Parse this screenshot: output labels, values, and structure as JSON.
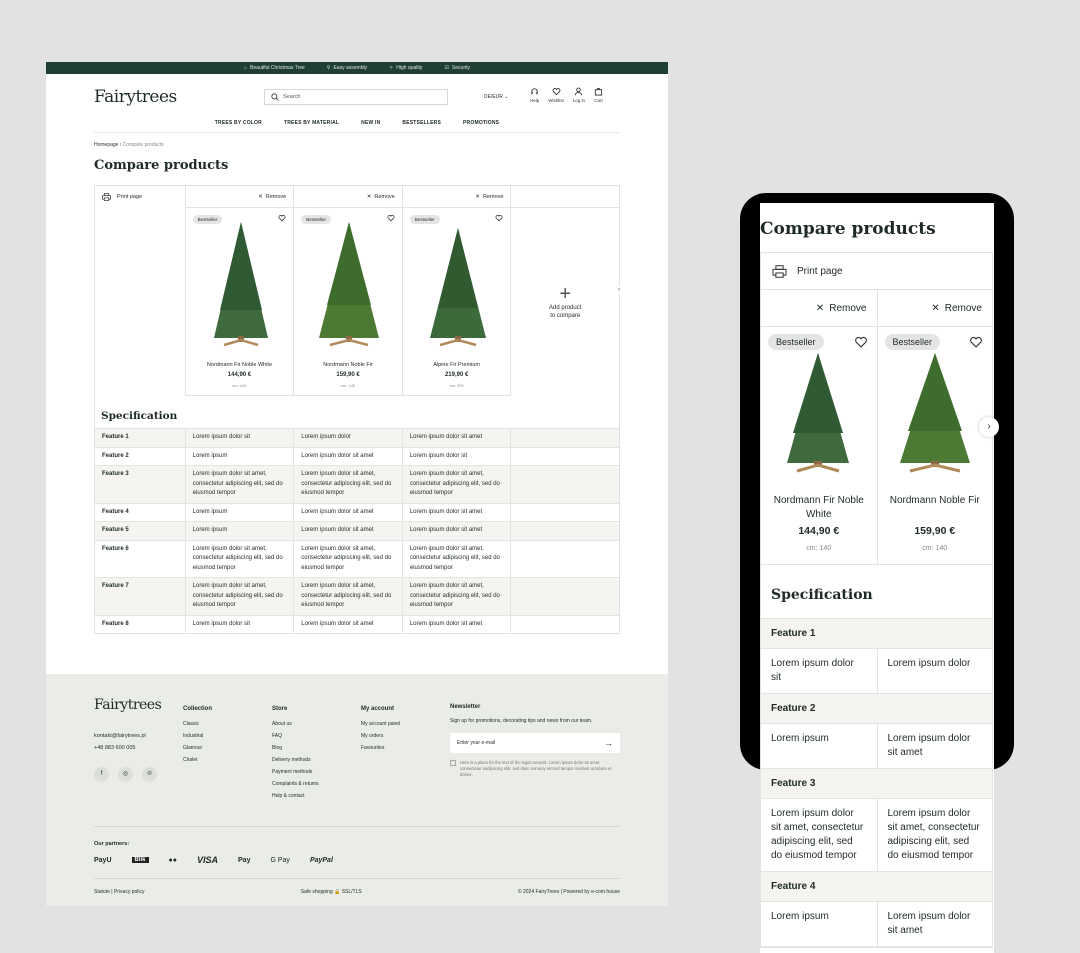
{
  "topbar": [
    "Beautiful Christmas Tree",
    "Easy assembly",
    "High quality",
    "Security"
  ],
  "header": {
    "logo": "Fairytrees",
    "search_placeholder": "Search",
    "lang": "DE/EUR",
    "icons": [
      "Help",
      "Wishlist",
      "Log in",
      "Cart"
    ]
  },
  "nav": [
    "TREES BY COLOR",
    "TREES BY MATERIAL",
    "NEW IN",
    "BESTSELLERS",
    "PROMOTIONS"
  ],
  "breadcrumb": {
    "home": "Homepage",
    "sep": "/",
    "current": "Compare products"
  },
  "title": "Compare products",
  "print_label": "Print page",
  "remove_label": "Remove",
  "add_label_1": "Add product",
  "add_label_2": "to compare",
  "products": [
    {
      "badge": "Bestseller",
      "name": "Nordmann Fir Noble White",
      "price": "144,90 €",
      "size": "cm: 140",
      "size_mobile": "cm:  140",
      "color": "#3f6a3e"
    },
    {
      "badge": "Bestseller",
      "name": "Nordmann Noble Fir",
      "price": "159,90 €",
      "size": "cm: 140",
      "size_mobile": "cm:  140",
      "color": "#4c7a34"
    },
    {
      "badge": "Bestseller",
      "name": "Alpine Fir Premium",
      "price": "219,90 €",
      "size": "cm: 200",
      "color": "#3d6a3a"
    }
  ],
  "spec_title": "Specification",
  "features": [
    {
      "name": "Feature 1",
      "values": [
        "Lorem ipsum dolor sit",
        "Lorem ipsum dolor",
        "Lorem ipsum dolor sit amet"
      ]
    },
    {
      "name": "Feature 2",
      "values": [
        "Lorem ipsum",
        "Lorem ipsum dolor sit amet",
        "Lorem ipsum dolor sit"
      ]
    },
    {
      "name": "Feature 3",
      "values": [
        "Lorem ipsum dolor sit amet, consectetur adipiscing elit, sed do eiusmod tempor",
        "Lorem ipsum dolor sit amet, consectetur adipiscing elit, sed do eiusmod tempor",
        "Lorem ipsum dolor sit amet, consectetur adipiscing elit, sed do eiusmod tempor"
      ]
    },
    {
      "name": "Feature 4",
      "values": [
        "Lorem ipsum",
        "Lorem ipsum dolor sit amet",
        "Lorem ipsum dolor sit amet"
      ]
    },
    {
      "name": "Feature 5",
      "values": [
        "Lorem ipsum",
        "Lorem ipsum dolor sit amet",
        "Lorem ipsum dolor sit amet"
      ]
    },
    {
      "name": "Feature 6",
      "values": [
        "Lorem ipsum dolor sit amet, consectetur adipiscing elit, sed do eiusmod tempor",
        "Lorem ipsum dolor sit amet, consectetur adipiscing elit, sed do eiusmod tempor",
        "Lorem ipsum dolor sit amet, consectetur adipiscing elit, sed do eiusmod tempor"
      ]
    },
    {
      "name": "Feature 7",
      "values": [
        "Lorem ipsum dolor sit amet, consectetur adipiscing elit, sed do eiusmod tempor",
        "Lorem ipsum dolor sit amet, consectetur adipiscing elit, sed do eiusmod tempor",
        "Lorem ipsum dolor sit amet, consectetur adipiscing elit, sed do eiusmod tempor"
      ]
    },
    {
      "name": "Feature 8",
      "values": [
        "Lorem ipsum dolor sit",
        "Lorem ipsum dolor sit amet",
        "Lorem ipsum dolor sit amet"
      ]
    }
  ],
  "footer": {
    "logo": "Fairytrees",
    "email": "kontakt@fairytrees.pl",
    "phone": "+48 883 600 005",
    "social": [
      "f",
      "◎",
      "℗"
    ],
    "collection": {
      "title": "Collection",
      "items": [
        "Classic",
        "Industrial",
        "Glamour",
        "Chalet"
      ]
    },
    "store": {
      "title": "Store",
      "items": [
        "About us",
        "FAQ",
        "Blog",
        "Delivery methods",
        "Payment methods",
        "Complaints & returns",
        "Help & contact"
      ]
    },
    "account": {
      "title": "My account",
      "items": [
        "My account panel",
        "My orders",
        "Favourites"
      ]
    },
    "newsletter": {
      "title": "Newsletter",
      "text": "Sign up for promotions, decorating tips and news from our team.",
      "placeholder": "Enter your e-mail",
      "consent": "Here is a place for the text of the legal consent. Lorem ipsum dolor sit amet, consectetur sadipscing elitr, sed diam nonumy eirmod tempor invidunt ut labore et dolore."
    },
    "partners_label": "Our partners:",
    "partners": [
      "PayU",
      "Blik",
      "●●",
      "VISA",
      "Pay",
      "G Pay",
      "PayPal"
    ],
    "statute": "Statute",
    "privacy": "Privacy policy",
    "safe": "Safe shopping",
    "ssl": "SSL/TLS",
    "copyright": "© 2024 FairyTrees | Powered by e-com.house"
  }
}
